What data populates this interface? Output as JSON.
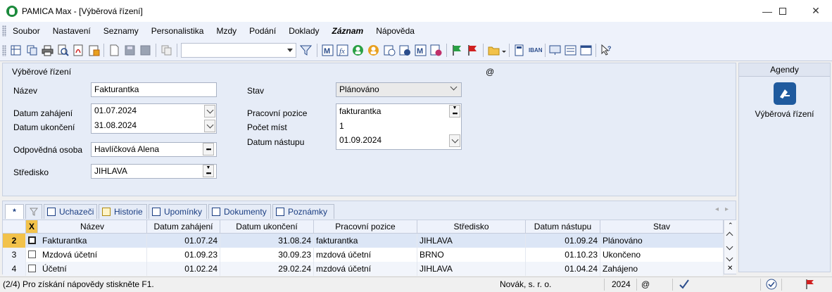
{
  "window": {
    "title": "PAMICA Max - [Výběrová řízení]"
  },
  "menu": [
    "Soubor",
    "Nastavení",
    "Seznamy",
    "Personalistika",
    "Mzdy",
    "Podání",
    "Doklady",
    "Záznam",
    "Nápověda"
  ],
  "form": {
    "section_title": "Výběrové řízení",
    "at_sign": "@",
    "nazev": {
      "label": "Název",
      "value": "Fakturantka"
    },
    "datum_zahajeni": {
      "label": "Datum zahájení",
      "value": "01.07.2024"
    },
    "datum_ukonceni": {
      "label": "Datum ukončení",
      "value": "31.08.2024"
    },
    "odpovedna_osoba": {
      "label": "Odpovědná osoba",
      "value": "Havlíčková Alena"
    },
    "stredisko": {
      "label": "Středisko",
      "value": "JIHLAVA"
    },
    "stav": {
      "label": "Stav",
      "value": "Plánováno"
    },
    "pracovni_pozice": {
      "label": "Pracovní pozice",
      "value": "fakturantka"
    },
    "pocet_mist": {
      "label": "Počet míst",
      "value": "1"
    },
    "datum_nastupu": {
      "label": "Datum nástupu",
      "value": "01.09.2024"
    }
  },
  "agendy": {
    "header": "Agendy",
    "item": "Výběrová řízení"
  },
  "tabs": {
    "star": "*",
    "items": [
      "Uchazeči",
      "Historie",
      "Upomínky",
      "Dokumenty",
      "Poznámky"
    ]
  },
  "grid": {
    "headers": [
      "X",
      "Název",
      "Datum zahájení",
      "Datum ukončení",
      "Pracovní pozice",
      "Středisko",
      "Datum nástupu",
      "Stav"
    ],
    "rows": [
      {
        "num": "2",
        "nazev": "Fakturantka",
        "zahajeni": "01.07.24",
        "ukonceni": "31.08.24",
        "pozice": "fakturantka",
        "stredisko": "JIHLAVA",
        "nastup": "01.09.24",
        "stav": "Plánováno"
      },
      {
        "num": "3",
        "nazev": "Mzdová účetní",
        "zahajeni": "01.09.23",
        "ukonceni": "30.09.23",
        "pozice": "mzdová účetní",
        "stredisko": "BRNO",
        "nastup": "01.10.23",
        "stav": "Ukončeno"
      },
      {
        "num": "4",
        "nazev": "Účetní",
        "zahajeni": "01.02.24",
        "ukonceni": "29.02.24",
        "pozice": "mzdová účetní",
        "stredisko": "JIHLAVA",
        "nastup": "01.04.24",
        "stav": "Zahájeno"
      }
    ]
  },
  "status": {
    "help": "(2/4) Pro získání nápovědy stiskněte F1.",
    "company": "Novák, s. r. o.",
    "year": "2024",
    "at": "@"
  }
}
